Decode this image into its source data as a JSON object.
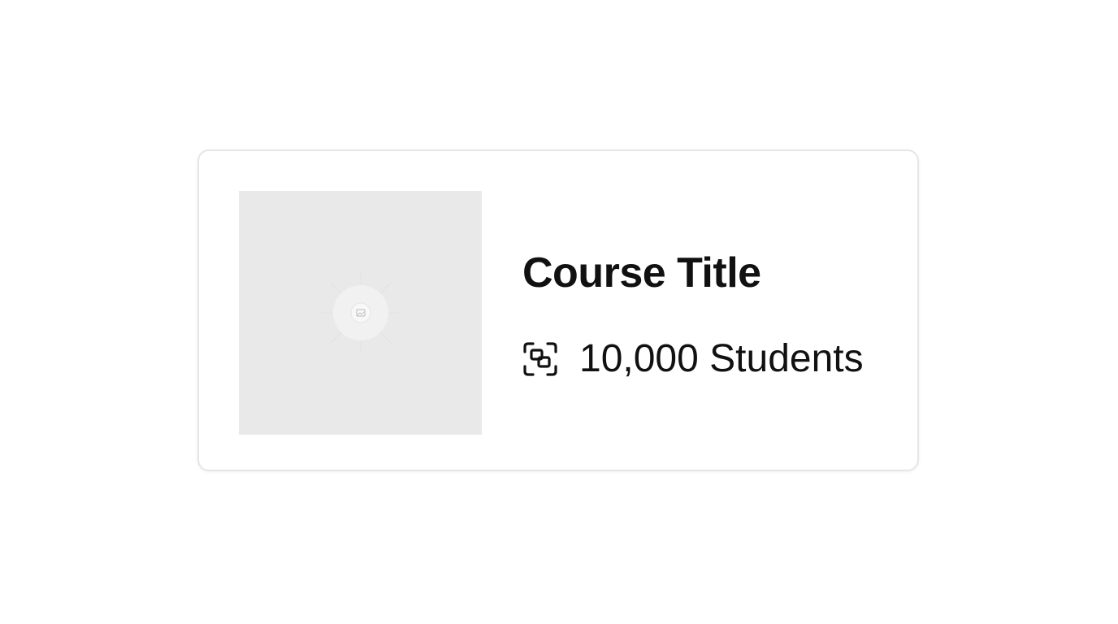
{
  "course_card": {
    "thumbnail_icon": "image-placeholder-icon",
    "title": "Course Title",
    "students_icon": "students-icon",
    "students_label": "10,000 Students"
  },
  "colors": {
    "card_border": "#e6e6e6",
    "thumbnail_bg": "#e9e9e9",
    "text": "#111111",
    "background": "#ffffff"
  }
}
